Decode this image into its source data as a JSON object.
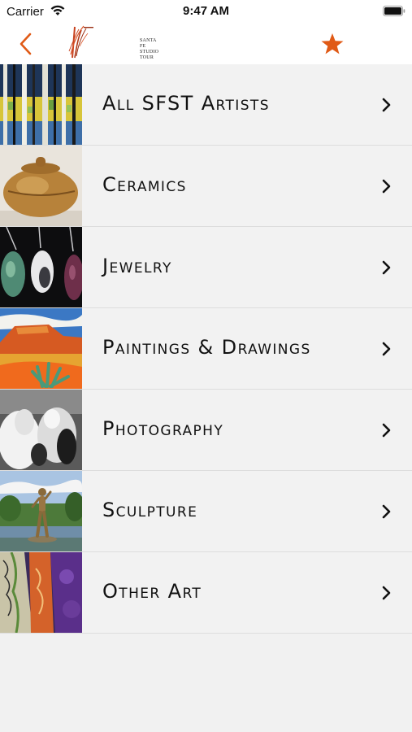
{
  "status_bar": {
    "carrier": "Carrier",
    "time": "9:47 AM"
  },
  "nav": {
    "back_icon": "chevron-left-icon",
    "favorite_icon": "star-icon",
    "accent_color": "#e05a16",
    "logo_lines": [
      "SANTA FE",
      "STUDIO",
      "TOUR"
    ]
  },
  "categories": [
    {
      "label": "All SFST Artists",
      "thumbnail": "painted aspen forest"
    },
    {
      "label": "Ceramics",
      "thumbnail": "copper clay pot"
    },
    {
      "label": "Jewelry",
      "thumbnail": "stone pendants"
    },
    {
      "label": "Paintings & Drawings",
      "thumbnail": "mesa landscape painting"
    },
    {
      "label": "Photography",
      "thumbnail": "horses photo"
    },
    {
      "label": "Sculpture",
      "thumbnail": "bronze figure by pond"
    },
    {
      "label": "Other Art",
      "thumbnail": "painted textiles"
    }
  ]
}
